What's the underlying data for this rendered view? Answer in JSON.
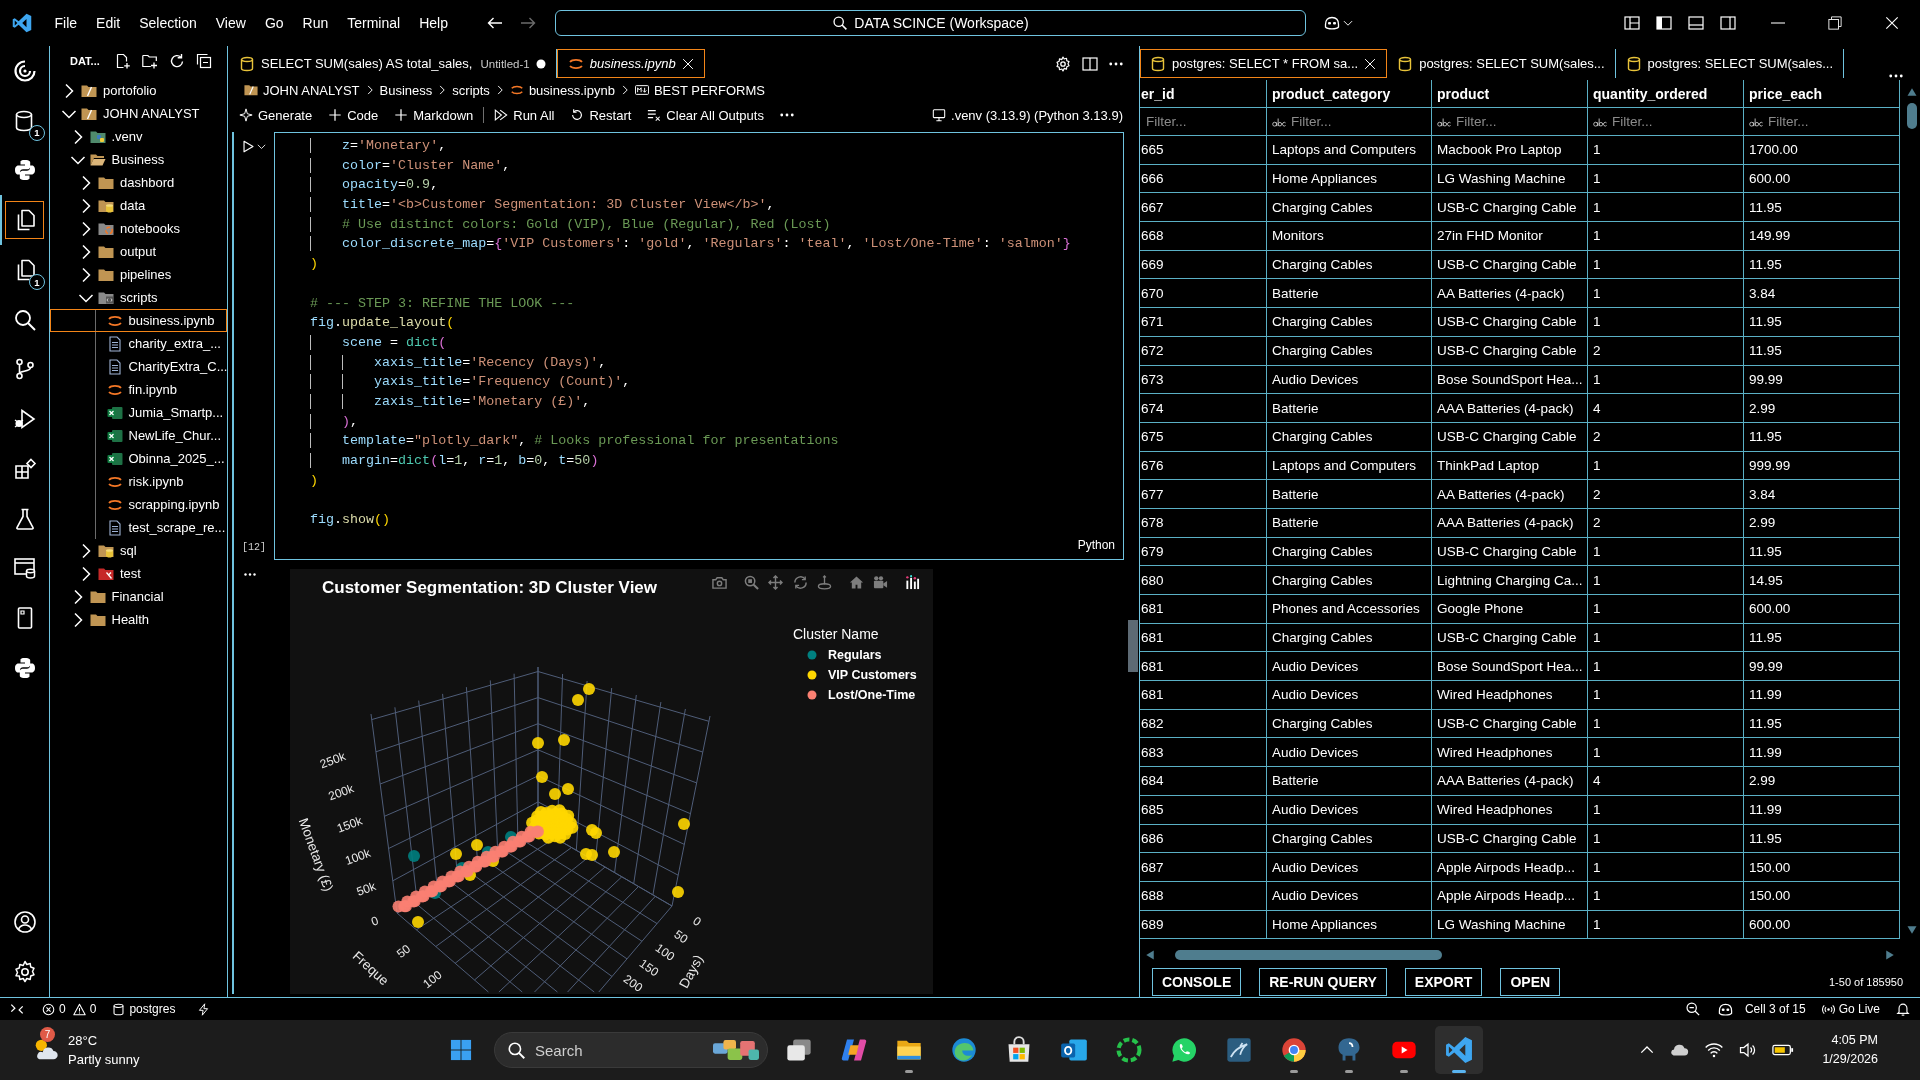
{
  "title_bar": {
    "menu": [
      "File",
      "Edit",
      "Selection",
      "View",
      "Go",
      "Run",
      "Terminal",
      "Help"
    ],
    "navigation": [
      {
        "kind": "back",
        "disabled": false
      },
      {
        "kind": "forward",
        "disabled": true
      }
    ],
    "command_center": "DATA SCINCE (Workspace)"
  },
  "activity_bar": {
    "items": [
      {
        "kind": "logo",
        "selected": false
      },
      {
        "kind": "database",
        "badge": "1",
        "selected": false
      },
      {
        "kind": "python",
        "selected": false
      },
      {
        "kind": "explorer",
        "selected": true
      },
      {
        "kind": "files",
        "badge": "1",
        "selected": false
      },
      {
        "kind": "search",
        "selected": false
      },
      {
        "kind": "source-control",
        "selected": false
      },
      {
        "kind": "run-debug",
        "selected": false
      },
      {
        "kind": "extensions",
        "selected": false
      },
      {
        "kind": "testing",
        "selected": false
      },
      {
        "kind": "db-window",
        "selected": false
      },
      {
        "kind": "notebook",
        "selected": false
      },
      {
        "kind": "python",
        "selected": false
      }
    ],
    "bottom": [
      {
        "kind": "account"
      },
      {
        "kind": "settings"
      }
    ]
  },
  "explorer": {
    "title": "DAT...",
    "tree": [
      {
        "label": "portofolio",
        "kind": "root-folder",
        "expanded": false,
        "selected": false
      },
      {
        "label": "JOHN ANALYST",
        "kind": "root-folder",
        "expanded": true,
        "selected": false,
        "children": [
          {
            "label": ".venv",
            "kind": "python-folder",
            "expanded": false,
            "selected": false
          },
          {
            "label": "Business",
            "kind": "folder",
            "expanded": true,
            "selected": false,
            "children": [
              {
                "label": "dashbord",
                "kind": "folder",
                "expanded": false,
                "selected": false
              },
              {
                "label": "data",
                "kind": "database-folder",
                "expanded": false,
                "selected": false
              },
              {
                "label": "notebooks",
                "kind": "notebook-folder",
                "expanded": false,
                "selected": false
              },
              {
                "label": "output",
                "kind": "folder",
                "expanded": false,
                "selected": false
              },
              {
                "label": "pipelines",
                "kind": "folder",
                "expanded": false,
                "selected": false
              },
              {
                "label": "scripts",
                "kind": "script-folder",
                "expanded": true,
                "selected": false,
                "children": [
                  {
                    "label": "business.ipynb",
                    "kind": "notebook",
                    "selected": true
                  },
                  {
                    "label": "charity_extra_...",
                    "kind": "document",
                    "selected": false
                  },
                  {
                    "label": "CharityExtra_C...",
                    "kind": "document",
                    "selected": false
                  },
                  {
                    "label": "fin.ipynb",
                    "kind": "notebook",
                    "selected": false
                  },
                  {
                    "label": "Jumia_Smartp...",
                    "kind": "spreadsheet",
                    "selected": false
                  },
                  {
                    "label": "NewLife_Chur...",
                    "kind": "spreadsheet",
                    "selected": false
                  },
                  {
                    "label": "Obinna_2025_...",
                    "kind": "spreadsheet",
                    "selected": false
                  },
                  {
                    "label": "risk.ipynb",
                    "kind": "notebook",
                    "selected": false
                  },
                  {
                    "label": "scrapping.ipynb",
                    "kind": "notebook",
                    "selected": false
                  },
                  {
                    "label": "test_scrape_re...",
                    "kind": "document",
                    "selected": false
                  }
                ]
              },
              {
                "label": "sql",
                "kind": "database-folder",
                "expanded": false,
                "selected": false
              },
              {
                "label": "test",
                "kind": "test-folder",
                "expanded": false,
                "selected": false
              }
            ]
          },
          {
            "label": "Financial",
            "kind": "folder",
            "expanded": false,
            "selected": false
          },
          {
            "label": "Health",
            "kind": "folder",
            "expanded": false,
            "selected": false
          }
        ]
      }
    ]
  },
  "editor": {
    "tabs": [
      {
        "label": "SELECT SUM(sales) AS total_sales,",
        "description": "Untitled-1",
        "kind": "query",
        "dirty": true,
        "preview": false,
        "selected": false
      },
      {
        "label": "business.ipynb",
        "kind": "notebook",
        "dirty": false,
        "preview": true,
        "selected": true
      }
    ],
    "breadcrumb": [
      {
        "label": "JOHN ANALYST",
        "kind": "root-folder"
      },
      {
        "label": "Business",
        "kind": "segment"
      },
      {
        "label": "scripts",
        "kind": "segment"
      },
      {
        "label": "business.ipynb",
        "kind": "notebook"
      },
      {
        "label": "BEST PERFORMS",
        "kind": "markdown"
      }
    ],
    "toolbar": [
      {
        "label": "Generate",
        "kind": "sparkle"
      },
      {
        "label": "Code",
        "kind": "add"
      },
      {
        "label": "Markdown",
        "kind": "add"
      },
      {
        "label": "Run All",
        "kind": "run-all"
      },
      {
        "label": "Restart",
        "kind": "restart"
      },
      {
        "label": "Clear All Outputs",
        "kind": "clear"
      }
    ],
    "kernel": ".venv (3.13.9) (Python 3.13.9)",
    "cell": {
      "execution_count": "[12]",
      "language": "Python",
      "code_blocks": [
        [
          "    z='Monetary',",
          "    color='Cluster Name',",
          "    opacity=0.9,",
          "    title='<b>Customer Segmentation: 3D Cluster View</b>',",
          "    # Use distinct colors: Gold (VIP), Blue (Regular), Red (Lost)",
          "    color_discrete_map={'VIP Customers': 'gold', 'Regulars': 'teal', 'Lost/One-Time': 'salmon'}",
          ")"
        ],
        [
          "# --- STEP 3: REFINE THE LOOK ---",
          "fig.update_layout(",
          "    scene = dict(",
          "        xaxis_title='Recency (Days)',",
          "        yaxis_title='Frequency (Count)',",
          "        zaxis_title='Monetary (£)',",
          "    ),",
          "    template=\"plotly_dark\", # Looks professional for presentations",
          "    margin=dict(l=1, r=1, b=0, t=50)",
          ")"
        ],
        [
          "fig.show()"
        ]
      ]
    },
    "output": {
      "title": "Customer Segmentation: 3D Cluster View",
      "legend": {
        "title": "Cluster Name",
        "items": [
          {
            "label": "Regulars",
            "color": "#008080"
          },
          {
            "label": "VIP Customers",
            "color": "#ffd700"
          },
          {
            "label": "Lost/One-Time",
            "color": "#fa8072"
          }
        ]
      },
      "z_axis": {
        "title": "Monetary (£)",
        "ticks": [
          "250k",
          "200k",
          "150k",
          "100k",
          "50k",
          "0"
        ]
      },
      "y_axis": {
        "title": "Freque",
        "ticks": [
          "50",
          "100"
        ]
      },
      "x_axis": {
        "title": "Days)",
        "ticks": [
          "0",
          "50",
          "100",
          "150",
          "200"
        ]
      }
    }
  },
  "results": {
    "tabs": [
      {
        "label": "postgres: SELECT * FROM sa...",
        "selected": true
      },
      {
        "label": "postgres: SELECT SUM(sales...",
        "selected": false
      },
      {
        "label": "postgres: SELECT SUM(sales...",
        "selected": false
      }
    ],
    "columns": [
      {
        "label": "er_id",
        "placeholder": "Filter...",
        "type_badge": false
      },
      {
        "label": "product_category",
        "placeholder": "Filter...",
        "type_badge": true
      },
      {
        "label": "product",
        "placeholder": "Filter...",
        "type_badge": true
      },
      {
        "label": "quantity_ordered",
        "placeholder": "Filter...",
        "type_badge": true
      },
      {
        "label": "price_each",
        "placeholder": "Filter...",
        "type_badge": true
      }
    ],
    "rows": [
      [
        "665",
        "Laptops and Computers",
        "Macbook Pro Laptop",
        "1",
        "1700.00"
      ],
      [
        "666",
        "Home Appliances",
        "LG Washing Machine",
        "1",
        "600.00"
      ],
      [
        "667",
        "Charging Cables",
        "USB-C Charging Cable",
        "1",
        "11.95"
      ],
      [
        "668",
        "Monitors",
        "27in FHD Monitor",
        "1",
        "149.99"
      ],
      [
        "669",
        "Charging Cables",
        "USB-C Charging Cable",
        "1",
        "11.95"
      ],
      [
        "670",
        "Batterie",
        "AA Batteries (4-pack)",
        "1",
        "3.84"
      ],
      [
        "671",
        "Charging Cables",
        "USB-C Charging Cable",
        "1",
        "11.95"
      ],
      [
        "672",
        "Charging Cables",
        "USB-C Charging Cable",
        "2",
        "11.95"
      ],
      [
        "673",
        "Audio Devices",
        "Bose SoundSport Hea...",
        "1",
        "99.99"
      ],
      [
        "674",
        "Batterie",
        "AAA Batteries (4-pack)",
        "4",
        "2.99"
      ],
      [
        "675",
        "Charging Cables",
        "USB-C Charging Cable",
        "2",
        "11.95"
      ],
      [
        "676",
        "Laptops and Computers",
        "ThinkPad Laptop",
        "1",
        "999.99"
      ],
      [
        "677",
        "Batterie",
        "AA Batteries (4-pack)",
        "2",
        "3.84"
      ],
      [
        "678",
        "Batterie",
        "AAA Batteries (4-pack)",
        "2",
        "2.99"
      ],
      [
        "679",
        "Charging Cables",
        "USB-C Charging Cable",
        "1",
        "11.95"
      ],
      [
        "680",
        "Charging Cables",
        "Lightning Charging Ca...",
        "1",
        "14.95"
      ],
      [
        "681",
        "Phones and Accessories",
        "Google Phone",
        "1",
        "600.00"
      ],
      [
        "681",
        "Charging Cables",
        "USB-C Charging Cable",
        "1",
        "11.95"
      ],
      [
        "681",
        "Audio Devices",
        "Bose SoundSport Hea...",
        "1",
        "99.99"
      ],
      [
        "681",
        "Audio Devices",
        "Wired Headphones",
        "1",
        "11.99"
      ],
      [
        "682",
        "Charging Cables",
        "USB-C Charging Cable",
        "1",
        "11.95"
      ],
      [
        "683",
        "Audio Devices",
        "Wired Headphones",
        "1",
        "11.99"
      ],
      [
        "684",
        "Batterie",
        "AAA Batteries (4-pack)",
        "4",
        "2.99"
      ],
      [
        "685",
        "Audio Devices",
        "Wired Headphones",
        "1",
        "11.99"
      ],
      [
        "686",
        "Charging Cables",
        "USB-C Charging Cable",
        "1",
        "11.95"
      ],
      [
        "687",
        "Audio Devices",
        "Apple Airpods Headp...",
        "1",
        "150.00"
      ],
      [
        "688",
        "Audio Devices",
        "Apple Airpods Headp...",
        "1",
        "150.00"
      ],
      [
        "689",
        "Home Appliances",
        "LG Washing Machine",
        "1",
        "600.00"
      ]
    ],
    "actions": [
      "CONSOLE",
      "RE-RUN QUERY",
      "EXPORT",
      "OPEN"
    ],
    "range": "1-50 of 185950"
  },
  "status_bar": {
    "errors": "0",
    "warnings": "0",
    "connection": "postgres",
    "cell": "Cell 3 of 15",
    "live_server": "Go Live"
  },
  "taskbar": {
    "weather": {
      "badge": "7",
      "temperature": "28°C",
      "condition": "Partly sunny"
    },
    "search": {
      "placeholder": "Search"
    },
    "apps": [
      {
        "kind": "task-view",
        "running": false,
        "active": false
      },
      {
        "kind": "assistant",
        "running": false,
        "active": false
      },
      {
        "kind": "files",
        "running": true,
        "active": false
      },
      {
        "kind": "wave-browser",
        "running": false,
        "active": false
      },
      {
        "kind": "store",
        "running": false,
        "active": false
      },
      {
        "kind": "mail",
        "running": false,
        "active": false
      },
      {
        "kind": "ring",
        "running": false,
        "active": false
      },
      {
        "kind": "chat",
        "running": false,
        "active": false
      },
      {
        "kind": "dolphin",
        "running": false,
        "active": false
      },
      {
        "kind": "ring-browser",
        "running": true,
        "active": false
      },
      {
        "kind": "elephant",
        "running": true,
        "active": false
      },
      {
        "kind": "video",
        "running": true,
        "active": false
      },
      {
        "kind": "code",
        "running": true,
        "active": true
      }
    ],
    "clock": {
      "time": "4:05 PM",
      "date": "1/29/2026"
    }
  }
}
